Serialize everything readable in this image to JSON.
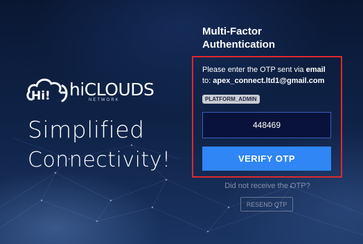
{
  "branding": {
    "logo_mark": "Hi!",
    "name": "hiCLOUDS",
    "subtitle": "NETWORK",
    "tagline_line1": "Simplified",
    "tagline_line2": "Connectivity!"
  },
  "mfa": {
    "title": "Multi-Factor Authentication",
    "message_prefix": "Please enter the OTP sent via ",
    "message_channel": "email",
    "message_to": "to: ",
    "email": "apex_connect.ltd1@gmail.com",
    "role_badge": "PLATFORM_ADMIN",
    "otp_value": "448469",
    "verify_label": "VERIFY OTP",
    "not_received_text": "Did not receive the OTP?",
    "resend_label": "RESEND OTP"
  },
  "colors": {
    "background": "#0c1b3a",
    "highlight_border": "#e0282f",
    "primary_button": "#2f86f4",
    "input_background": "#09123a",
    "badge_background": "#c9ccd3"
  },
  "icons": {
    "logo": "cloud-logo-icon"
  }
}
